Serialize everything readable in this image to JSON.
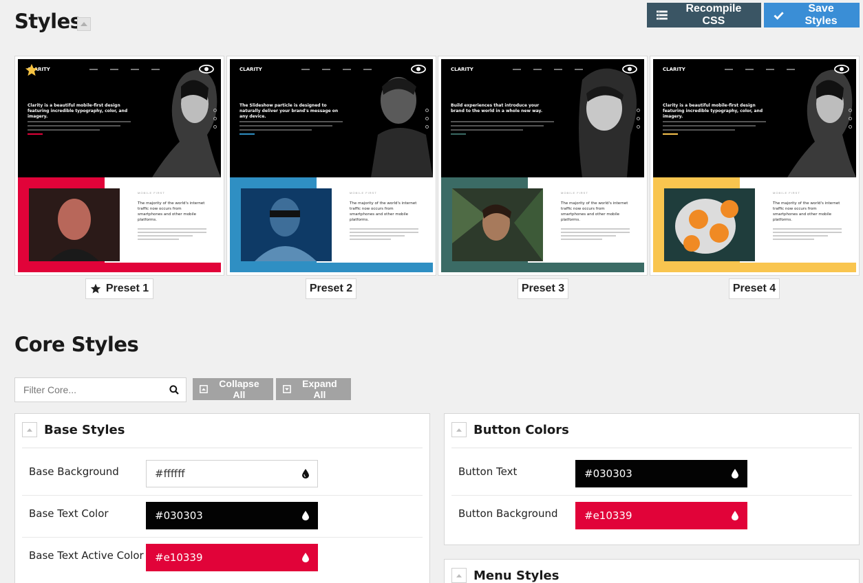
{
  "header": {
    "title": "Styles",
    "recompile_label": "Recompile CSS",
    "save_label": "Save Styles"
  },
  "presets": [
    {
      "label": "Preset 1",
      "default": true,
      "accent": "#e10339",
      "hero_text": "Clarity is a beautiful mobile-first design featuring incredible typography, color, and imagery."
    },
    {
      "label": "Preset 2",
      "default": false,
      "accent": "#2f8fc3",
      "hero_text": "The Slideshow particle is designed to naturally deliver your brand's message on any device."
    },
    {
      "label": "Preset 3",
      "default": false,
      "accent": "#3b6b65",
      "hero_text": "Build experiences that introduce your brand to the world in a whole new way."
    },
    {
      "label": "Preset 4",
      "default": false,
      "accent": "#f9c54f",
      "hero_text": "Clarity is a beautiful mobile-first design featuring incredible typography, color, and imagery."
    }
  ],
  "preset_common": {
    "logo": "CLARITY",
    "kicker": "MOBILE FIRST",
    "feature_heading": "The majority of the world's internet traffic now occurs from smartphones and other mobile platforms."
  },
  "core": {
    "title": "Core Styles",
    "filter_placeholder": "Filter Core...",
    "collapse_all": "Collapse All",
    "expand_all": "Expand All"
  },
  "base_styles": {
    "title": "Base Styles",
    "rows": [
      {
        "label": "Base Background",
        "value": "#ffffff"
      },
      {
        "label": "Base Text Color",
        "value": "#030303"
      },
      {
        "label": "Base Text Active Color",
        "value": "#e10339"
      }
    ]
  },
  "button_colors": {
    "title": "Button Colors",
    "rows": [
      {
        "label": "Button Text",
        "value": "#030303"
      },
      {
        "label": "Button Background",
        "value": "#e10339"
      }
    ]
  },
  "menu_styles": {
    "title": "Menu Styles"
  }
}
